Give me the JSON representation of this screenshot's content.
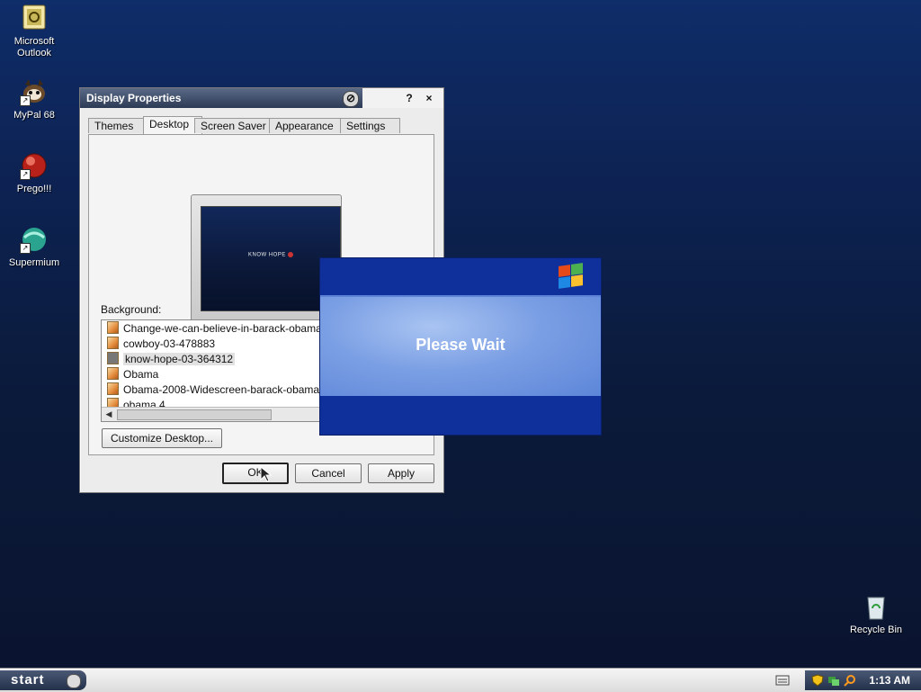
{
  "desktop": {
    "icons": [
      {
        "label": "Microsoft Outlook",
        "name": "outlook-icon"
      },
      {
        "label": "MyPal 68",
        "name": "mypal-icon"
      },
      {
        "label": "Prego!!!",
        "name": "prego-icon"
      },
      {
        "label": "Supermium",
        "name": "supermium-icon"
      },
      {
        "label": "Recycle Bin",
        "name": "recycle-bin-icon"
      }
    ]
  },
  "window": {
    "title": "Display Properties",
    "help": "?",
    "close": "×",
    "tabs": [
      "Themes",
      "Desktop",
      "Screen Saver",
      "Appearance",
      "Settings"
    ],
    "active_tab": "Desktop",
    "preview_text": "KNOW HOPE",
    "background_label": "Background:",
    "background_items": [
      "Change-we-can-believe-in-barack-obama-2776",
      "cowboy-03-478883",
      "know-hope-03-364312",
      "Obama",
      "Obama-2008-Widescreen-barack-obama-7388",
      "obama 4"
    ],
    "selected_background": "know-hope-03-364312",
    "customize_button": "Customize Desktop...",
    "ok_button": "OK",
    "cancel_button": "Cancel",
    "apply_button": "Apply"
  },
  "wait_dialog": {
    "message": "Please Wait"
  },
  "taskbar": {
    "start_label": "start",
    "clock": "1:13 AM"
  }
}
